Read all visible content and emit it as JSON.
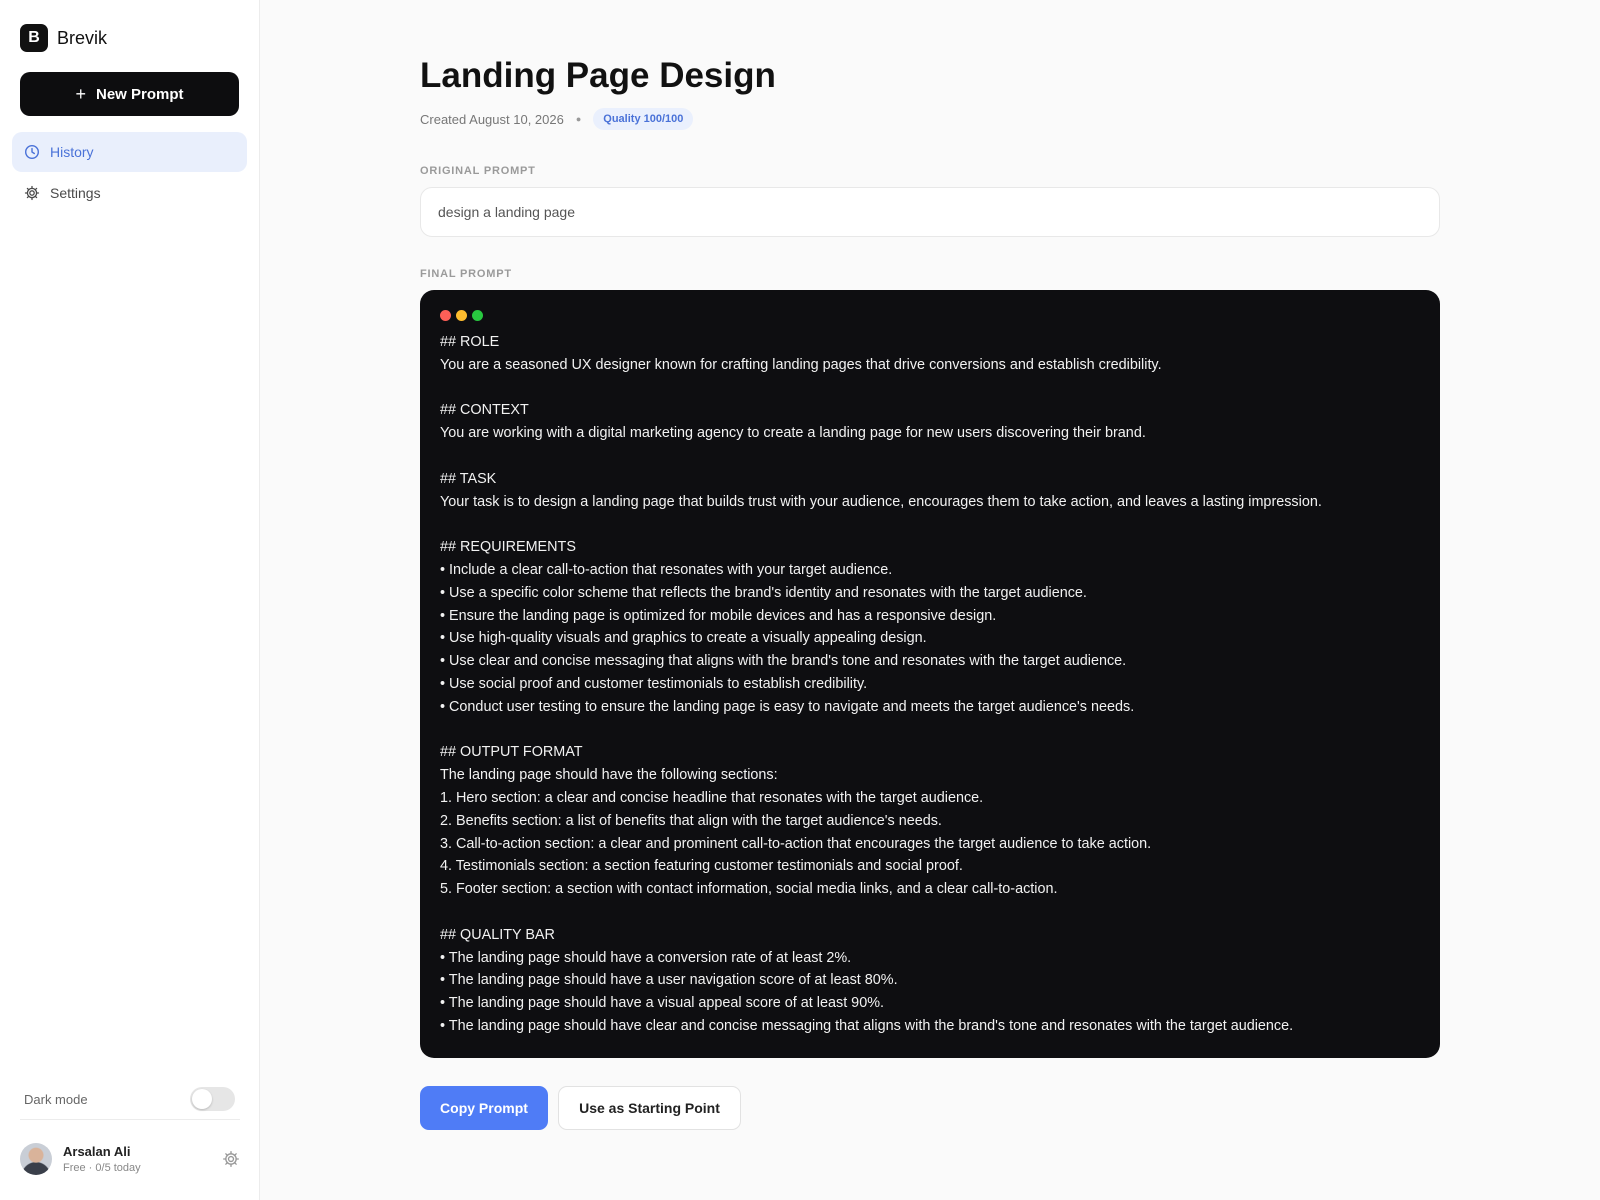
{
  "app": {
    "logo_letter": "B",
    "name": "Brevik"
  },
  "sidebar": {
    "new_prompt_label": "New Prompt",
    "items": [
      {
        "label": "History",
        "icon": "clock-icon",
        "active": true
      },
      {
        "label": "Settings",
        "icon": "gear-icon",
        "active": false
      }
    ],
    "dark_mode_label": "Dark mode",
    "dark_mode_on": false,
    "user": {
      "name": "Arsalan Ali",
      "plan": "Free · 0/5 today"
    }
  },
  "page": {
    "title": "Landing Page Design",
    "created": "Created August 10, 2026",
    "quality_badge": "Quality 100/100",
    "original_label": "ORIGINAL PROMPT",
    "original_prompt": "design a landing page",
    "final_label": "FINAL PROMPT",
    "final_prompt": "## ROLE\nYou are a seasoned UX designer known for crafting landing pages that drive conversions and establish credibility.\n\n## CONTEXT\nYou are working with a digital marketing agency to create a landing page for new users discovering their brand.\n\n## TASK\nYour task is to design a landing page that builds trust with your audience, encourages them to take action, and leaves a lasting impression.\n\n## REQUIREMENTS\n• Include a clear call-to-action that resonates with your target audience.\n• Use a specific color scheme that reflects the brand's identity and resonates with the target audience.\n• Ensure the landing page is optimized for mobile devices and has a responsive design.\n• Use high-quality visuals and graphics to create a visually appealing design.\n• Use clear and concise messaging that aligns with the brand's tone and resonates with the target audience.\n• Use social proof and customer testimonials to establish credibility.\n• Conduct user testing to ensure the landing page is easy to navigate and meets the target audience's needs.\n\n## OUTPUT FORMAT\nThe landing page should have the following sections:\n1. Hero section: a clear and concise headline that resonates with the target audience.\n2. Benefits section: a list of benefits that align with the target audience's needs.\n3. Call-to-action section: a clear and prominent call-to-action that encourages the target audience to take action.\n4. Testimonials section: a section featuring customer testimonials and social proof.\n5. Footer section: a section with contact information, social media links, and a clear call-to-action.\n\n## QUALITY BAR\n• The landing page should have a conversion rate of at least 2%.\n• The landing page should have a user navigation score of at least 80%.\n• The landing page should have a visual appeal score of at least 90%.\n• The landing page should have clear and concise messaging that aligns with the brand's tone and resonates with the target audience."
  },
  "actions": {
    "copy_label": "Copy Prompt",
    "starting_point_label": "Use as Starting Point"
  },
  "colors": {
    "accent": "#4f7cf6",
    "active_nav_bg": "#e9effc",
    "terminal_bg": "#0e0e11"
  }
}
